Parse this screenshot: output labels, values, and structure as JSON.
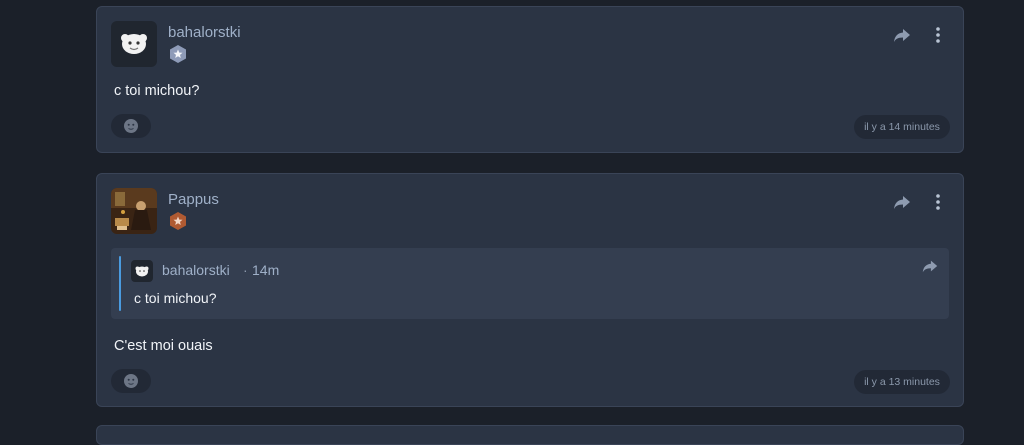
{
  "posts": [
    {
      "username": "bahalorstki",
      "badge_icon": "star-shield-badge-icon",
      "badge_color": "#8e9bb8",
      "body": "c toi michou?",
      "timestamp": "il y a 14 minutes"
    },
    {
      "username": "Pappus",
      "badge_icon": "star-shield-badge-icon",
      "badge_color": "#b05a32",
      "quote": {
        "username": "bahalorstki",
        "separator": "·",
        "time": "14m",
        "text": "c toi michou?"
      },
      "body": "C'est moi ouais",
      "timestamp": "il y a 13 minutes"
    }
  ],
  "colors": {
    "page_bg": "#1b2029",
    "card_bg": "#2b3444",
    "quote_bg": "#343e50",
    "quote_accent": "#4a9be0",
    "username": "#9fb0c8",
    "text": "#f1f4f8"
  }
}
